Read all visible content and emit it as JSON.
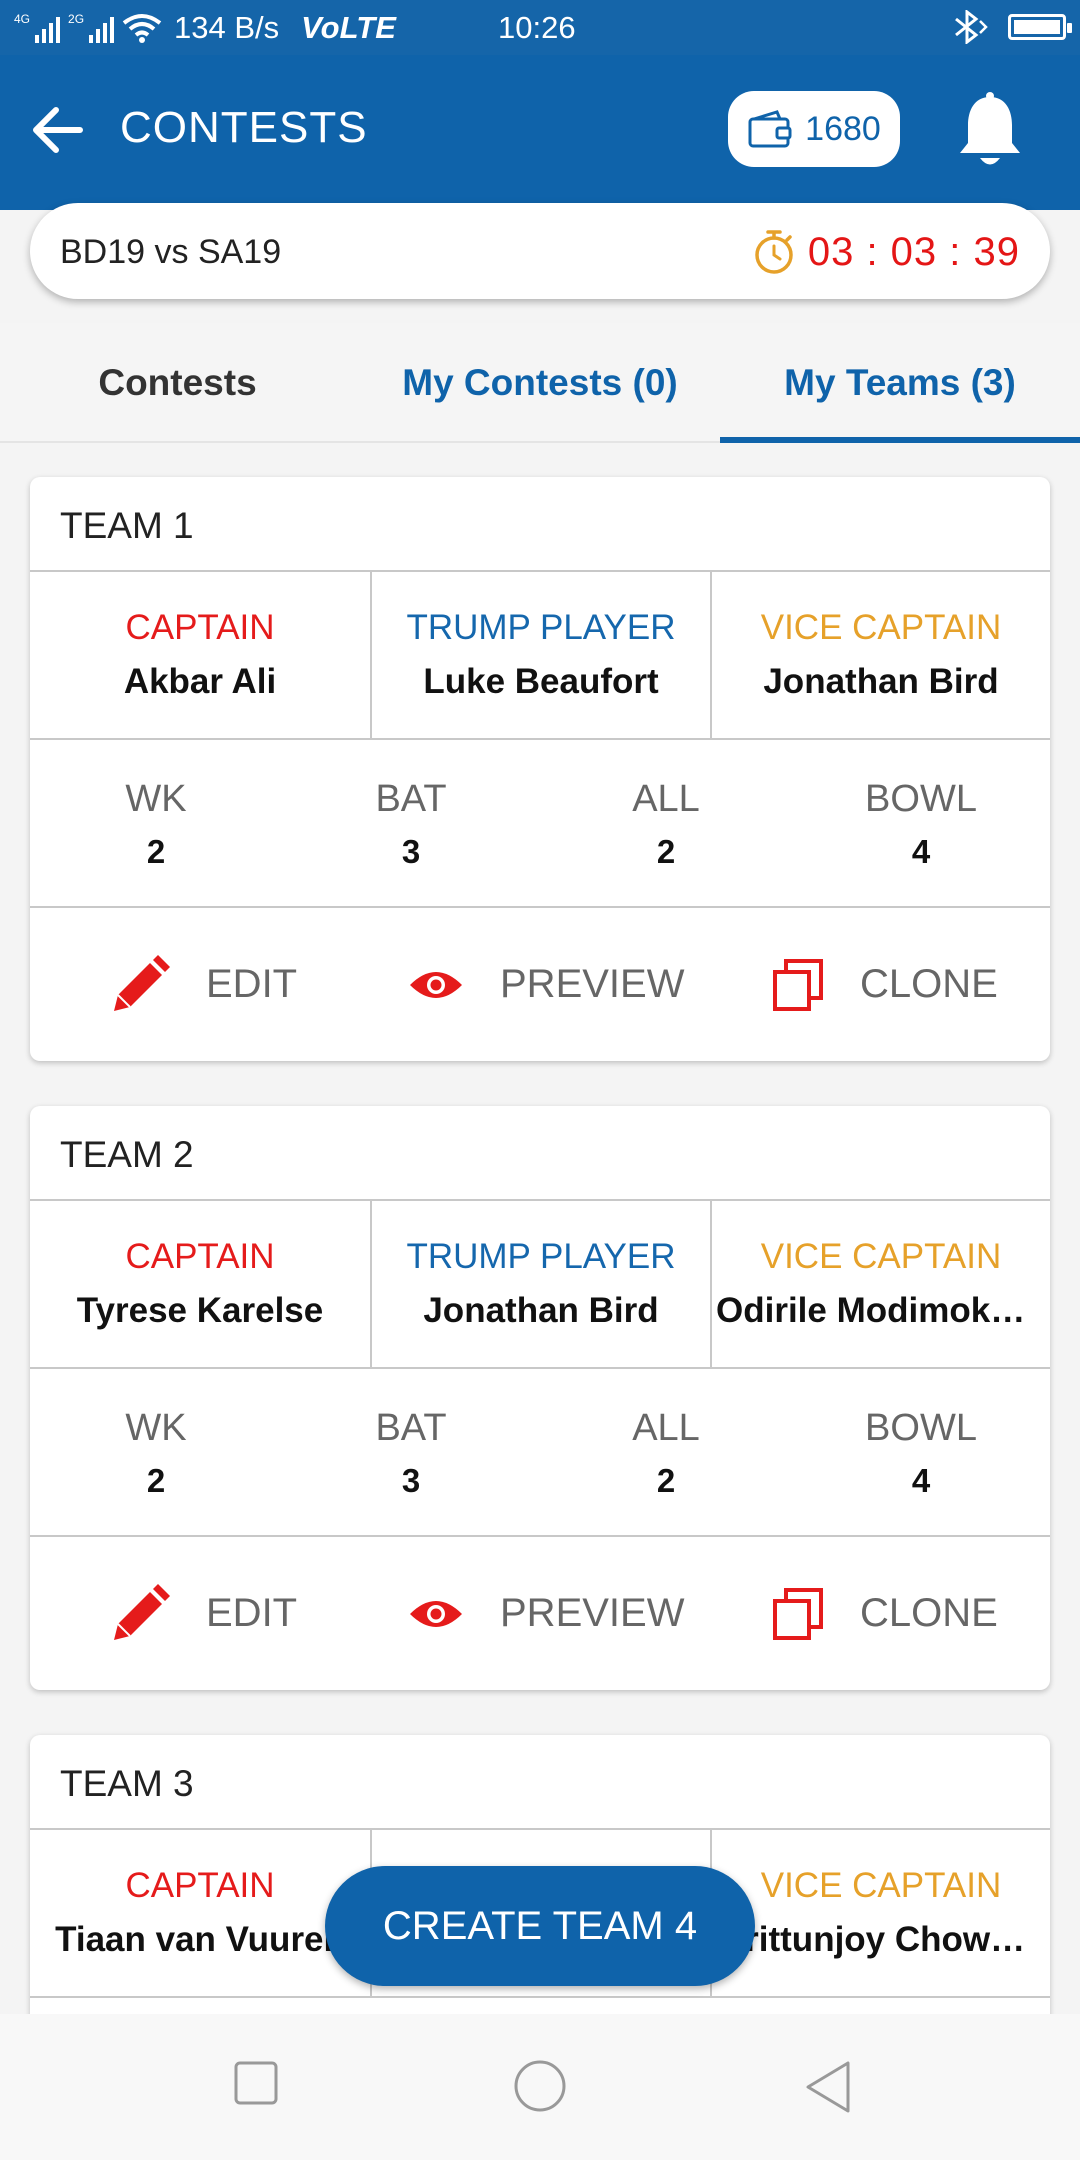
{
  "status_bar": {
    "net_label": "4G",
    "net_label_2": "2G",
    "speed": "134 B/s",
    "volte": "VoLTE",
    "time": "10:26"
  },
  "app_bar": {
    "title": "CONTESTS",
    "wallet_balance": "1680"
  },
  "match": {
    "name": "BD19 vs SA19",
    "countdown": "03 : 03 : 39"
  },
  "tabs": [
    {
      "label": "Contests",
      "active": false
    },
    {
      "label": "My Contests (0)",
      "active": false
    },
    {
      "label": "My Teams (3)",
      "active": true
    }
  ],
  "role_labels": {
    "captain": "CAPTAIN",
    "trump": "TRUMP PLAYER",
    "vice": "VICE CAPTAIN"
  },
  "stat_labels": {
    "wk": "WK",
    "bat": "BAT",
    "all": "ALL",
    "bowl": "BOWL"
  },
  "action_labels": {
    "edit": "EDIT",
    "preview": "PREVIEW",
    "clone": "CLONE"
  },
  "teams": [
    {
      "title": "TEAM 1",
      "captain": "Akbar Ali",
      "trump": "Luke Beaufort",
      "vice": "Jonathan Bird",
      "wk": "2",
      "bat": "3",
      "all": "2",
      "bowl": "4"
    },
    {
      "title": "TEAM 2",
      "captain": "Tyrese Karelse",
      "trump": "Jonathan Bird",
      "vice": "Odirile Modimokoa…",
      "wk": "2",
      "bat": "3",
      "all": "2",
      "bowl": "4"
    },
    {
      "title": "TEAM 3",
      "captain": "Tiaan van Vuuren",
      "trump": "",
      "vice": "Mrittunjoy Chowdh…"
    }
  ],
  "create_button": "CREATE TEAM 4",
  "colors": {
    "primary": "#0f63aa",
    "captain": "#e51b1b",
    "trump": "#1567ad",
    "vice": "#e6a12a",
    "timer": "#e41616"
  }
}
